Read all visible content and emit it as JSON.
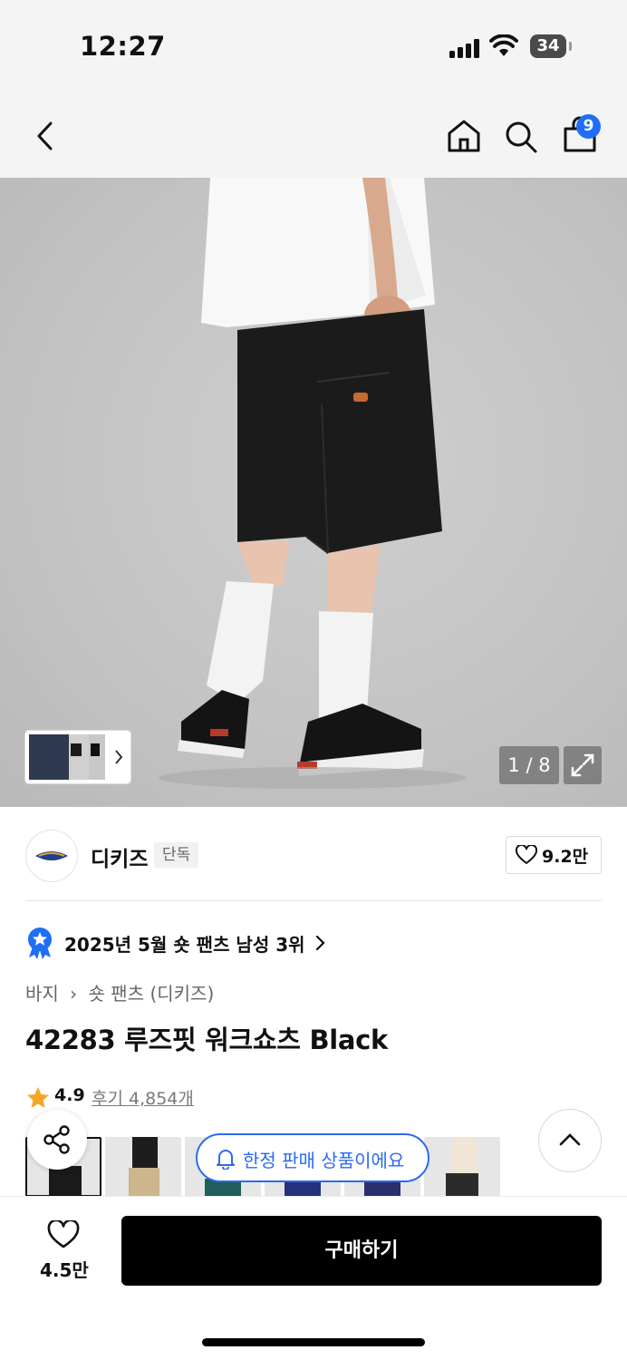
{
  "status": {
    "time": "12:27",
    "battery": "34"
  },
  "header": {
    "back_icon": "chevron-left-icon",
    "home_icon": "home-icon",
    "search_icon": "search-icon",
    "cart_icon": "shopping-bag-icon",
    "cart_count": "9"
  },
  "gallery": {
    "counter": "1 / 8",
    "expand_icon": "expand-icon"
  },
  "brand": {
    "name": "디키즈",
    "tag": "단독",
    "likes": "9.2만"
  },
  "ranking": {
    "text": "2025년 5월 숏 팬츠 남성 3위"
  },
  "breadcrumb": {
    "category": "바지",
    "subcategory": "숏 팬츠 (디키즈)"
  },
  "product": {
    "title": "42283 루즈핏 워크쇼츠 Black"
  },
  "rating": {
    "score": "4.9",
    "reviews": "후기 4,854개"
  },
  "notice": {
    "limited": "한정 판매 상품이에요"
  },
  "bottom": {
    "wish_count": "4.5만",
    "buy_label": "구매하기"
  },
  "colors": {
    "accent": "#1e6ef6",
    "buy_button": "#000000"
  }
}
